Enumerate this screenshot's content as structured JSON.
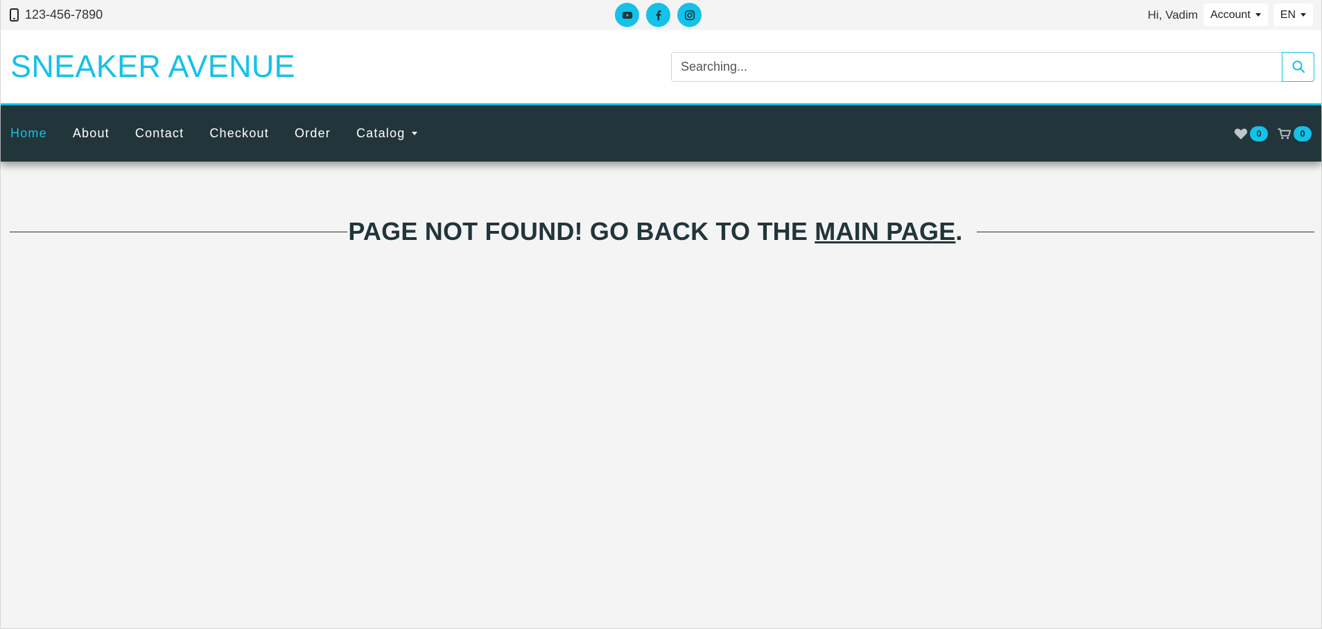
{
  "topbar": {
    "phone": "123-456-7890",
    "greeting": "Hi, Vadim",
    "account_label": "Account",
    "language_label": "EN",
    "social": [
      "youtube-icon",
      "facebook-icon",
      "instagram-icon"
    ]
  },
  "header": {
    "logo": "SNEAKER AVENUE",
    "search_placeholder": "Searching..."
  },
  "nav": {
    "links": [
      {
        "label": "Home",
        "active": true
      },
      {
        "label": "About"
      },
      {
        "label": "Contact"
      },
      {
        "label": "Checkout"
      },
      {
        "label": "Order"
      },
      {
        "label": "Catalog"
      }
    ],
    "wishlist_count": "0",
    "cart_count": "0"
  },
  "main": {
    "message_prefix": "PAGE NOT FOUND! GO BACK TO THE ",
    "link_text": "MAIN PAGE",
    "message_suffix": "."
  },
  "colors": {
    "accent": "#13c2e8",
    "navbar": "#22353b",
    "background": "#f4f4f4"
  }
}
